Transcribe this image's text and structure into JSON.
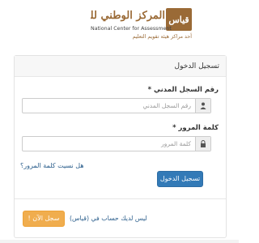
{
  "header": {
    "logo_mark": "قياس",
    "logo_title_ar": "المركز الوطني للقياس",
    "logo_title_en": "National Center for Assessment",
    "logo_tagline_ar": "أحد مراكز هيئة تقويم التعليم"
  },
  "panel": {
    "title": "تسجيل الدخول",
    "civil_id": {
      "label": "رقم السجل المدني *",
      "placeholder": "رقم السجل المدني",
      "icon": "user-icon"
    },
    "password": {
      "label": "كلمة المرور *",
      "placeholder": "كلمة المرور",
      "icon": "lock-icon"
    },
    "forgot_password": "هل نسيت كلمة المرور؟",
    "login_button": "تسجيل الدخول",
    "no_account_text": "ليس لديك حساب في (قياس)",
    "register_button": "سجل الآن !"
  },
  "colors": {
    "brand": "#9a6a36",
    "primary": "#337ab7",
    "warning": "#f0ad4e",
    "link": "#2b5e8c"
  }
}
